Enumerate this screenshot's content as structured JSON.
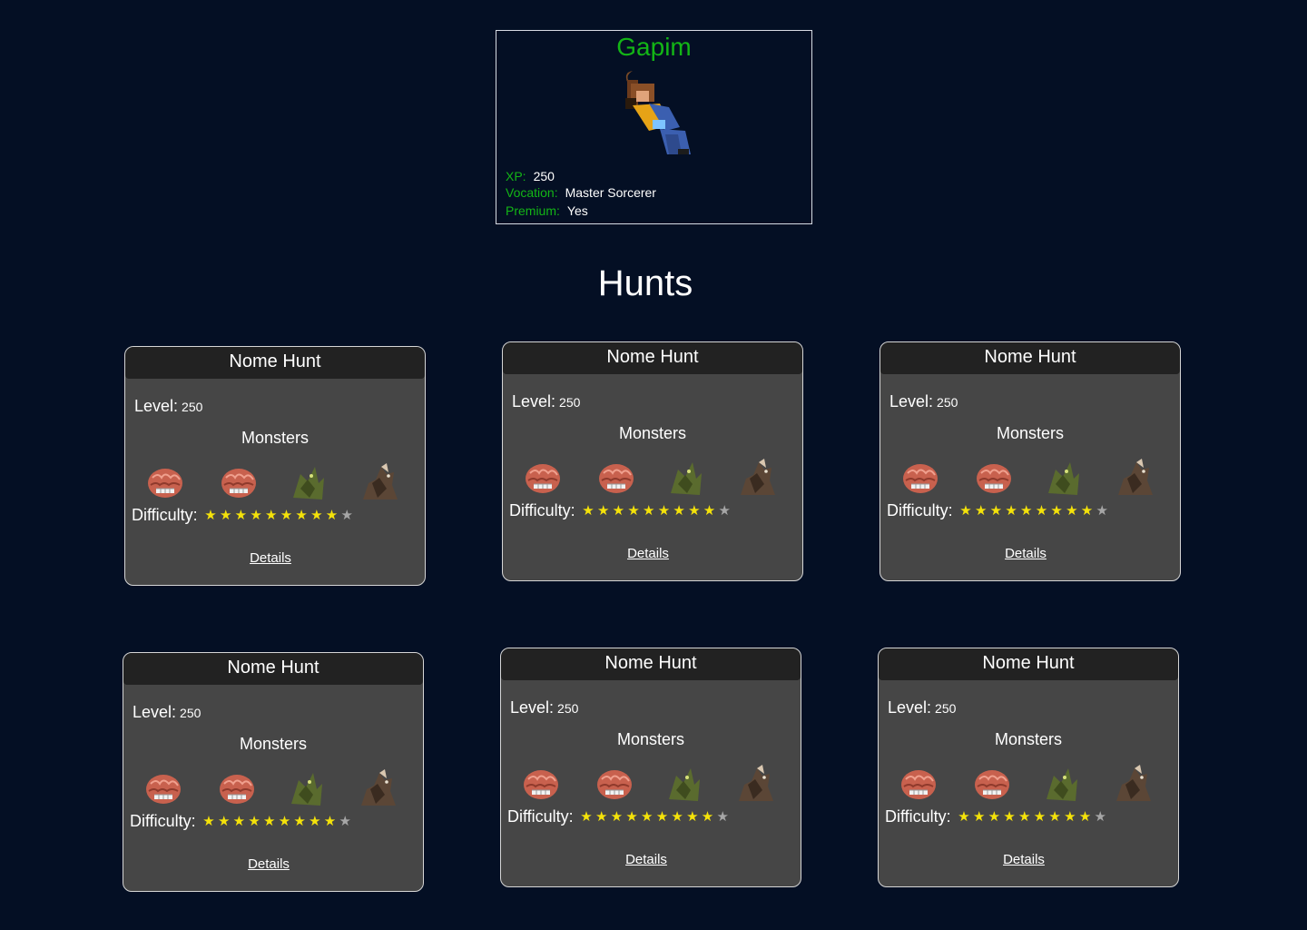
{
  "profile": {
    "name": "Gapim",
    "xp_label": "XP:",
    "xp": "250",
    "vocation_label": "Vocation:",
    "vocation": "Master Sorcerer",
    "premium_label": "Premium:",
    "premium": "Yes"
  },
  "section_title": "Hunts",
  "hunts": [
    {
      "title": "Nome Hunt",
      "level_label": "Level:",
      "level": "250",
      "monsters_label": "Monsters",
      "difficulty_label": "Difficulty:",
      "difficulty": 9,
      "difficulty_max": 10,
      "details_label": "Details"
    },
    {
      "title": "Nome Hunt",
      "level_label": "Level:",
      "level": "250",
      "monsters_label": "Monsters",
      "difficulty_label": "Difficulty:",
      "difficulty": 9,
      "difficulty_max": 10,
      "details_label": "Details"
    },
    {
      "title": "Nome Hunt",
      "level_label": "Level:",
      "level": "250",
      "monsters_label": "Monsters",
      "difficulty_label": "Difficulty:",
      "difficulty": 9,
      "difficulty_max": 10,
      "details_label": "Details"
    },
    {
      "title": "Nome Hunt",
      "level_label": "Level:",
      "level": "250",
      "monsters_label": "Monsters",
      "difficulty_label": "Difficulty:",
      "difficulty": 9,
      "difficulty_max": 10,
      "details_label": "Details"
    },
    {
      "title": "Nome Hunt",
      "level_label": "Level:",
      "level": "250",
      "monsters_label": "Monsters",
      "difficulty_label": "Difficulty:",
      "difficulty": 9,
      "difficulty_max": 10,
      "details_label": "Details"
    },
    {
      "title": "Nome Hunt",
      "level_label": "Level:",
      "level": "250",
      "monsters_label": "Monsters",
      "difficulty_label": "Difficulty:",
      "difficulty": 9,
      "difficulty_max": 10,
      "details_label": "Details"
    }
  ],
  "monster_icons": [
    "brain-monster-icon",
    "brain-monster-icon",
    "green-dragon-icon",
    "brown-beast-icon"
  ],
  "colors": {
    "background": "#040f24",
    "accent_green": "#13b516",
    "card_bg": "#464646",
    "card_header": "#222222",
    "star_on": "#f4e20a",
    "star_off": "#a6a6a6"
  }
}
